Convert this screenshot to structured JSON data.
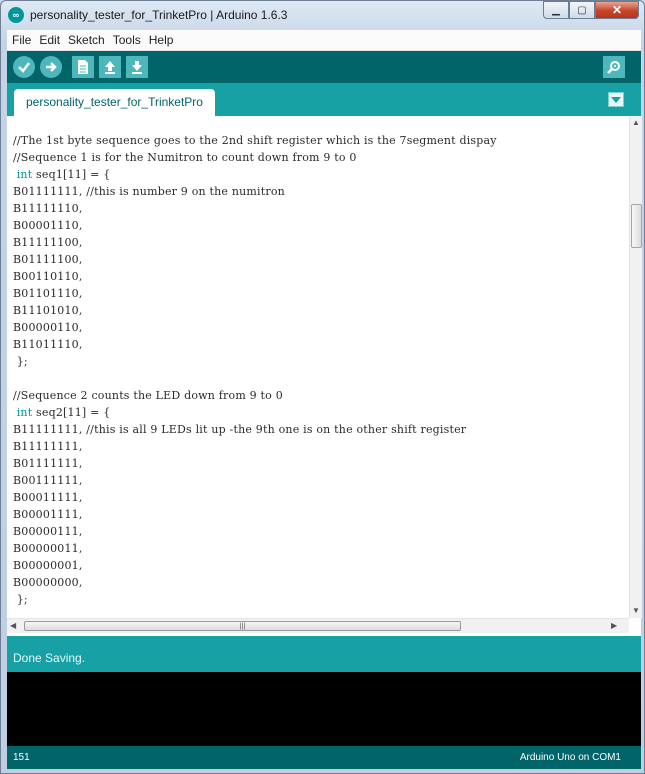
{
  "window": {
    "title": "personality_tester_for_TrinketPro | Arduino 1.6.3",
    "icon": "arduino-infinity-icon",
    "controls": {
      "minimize": "minimize-icon",
      "maximize": "maximize-icon",
      "close": "close-icon"
    }
  },
  "menu": [
    "File",
    "Edit",
    "Sketch",
    "Tools",
    "Help"
  ],
  "toolbar": {
    "buttons": [
      "verify-icon",
      "upload-icon",
      "new-icon",
      "open-icon",
      "save-icon"
    ],
    "right": "serial-monitor-icon"
  },
  "tabs": [
    "personality_tester_for_TrinketPro"
  ],
  "code": [
    {
      "text": "//The 1st byte sequence goes to the 2nd shift register which is the 7segment dispay"
    },
    {
      "text": "//Sequence 1 is for the Numitron to count down from 9 to 0"
    },
    {
      "kw": " int",
      "text": " seq1[11] = {"
    },
    {
      "text": "B01111111, //this is number 9 on the numitron"
    },
    {
      "text": "B11111110,"
    },
    {
      "text": "B00001110,"
    },
    {
      "text": "B11111100,"
    },
    {
      "text": "B01111100,"
    },
    {
      "text": "B00110110,"
    },
    {
      "text": "B01101110,"
    },
    {
      "text": "B11101010,"
    },
    {
      "text": "B00000110,"
    },
    {
      "text": "B11011110,"
    },
    {
      "text": " };"
    },
    {
      "text": ""
    },
    {
      "text": "//Sequence 2 counts the LED down from 9 to 0"
    },
    {
      "kw": " int",
      "text": " seq2[11] = {"
    },
    {
      "text": "B11111111, //this is all 9 LEDs lit up -the 9th one is on the other shift register"
    },
    {
      "text": "B11111111,"
    },
    {
      "text": "B01111111,"
    },
    {
      "text": "B00111111,"
    },
    {
      "text": "B00011111,"
    },
    {
      "text": "B00001111,"
    },
    {
      "text": "B00000111,"
    },
    {
      "text": "B00000011,"
    },
    {
      "text": "B00000001,"
    },
    {
      "text": "B00000000,"
    },
    {
      "text": " };"
    }
  ],
  "status": {
    "message": "Done Saving."
  },
  "footer": {
    "line": "151",
    "board": "Arduino Uno on COM1"
  },
  "colors": {
    "teal_dark": "#006468",
    "teal": "#17a1a5",
    "keyword": "#00979c"
  }
}
